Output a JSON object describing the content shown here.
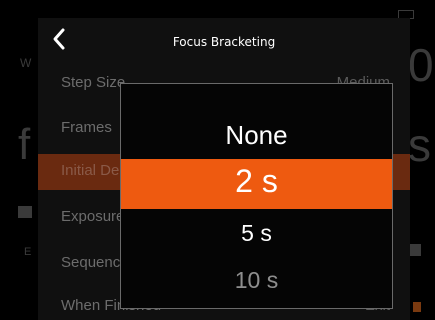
{
  "header": {
    "title": "Focus Bracketing"
  },
  "menu": {
    "rows": [
      {
        "label": "Step Size",
        "value": "Medium"
      },
      {
        "label": "Frames",
        "value": ""
      },
      {
        "label": "Initial Delay",
        "value": ""
      },
      {
        "label": "Exposure Smoothing",
        "value": ""
      },
      {
        "label": "Sequence",
        "value": ""
      },
      {
        "label": "When Finished",
        "value": "Exit"
      }
    ]
  },
  "picker": {
    "options": [
      "None",
      "2 s",
      "5 s",
      "10 s"
    ],
    "selected_index": 1,
    "highlight_color": "#ee5a10"
  },
  "colors": {
    "selected_row_bg": "#6a2a10"
  }
}
